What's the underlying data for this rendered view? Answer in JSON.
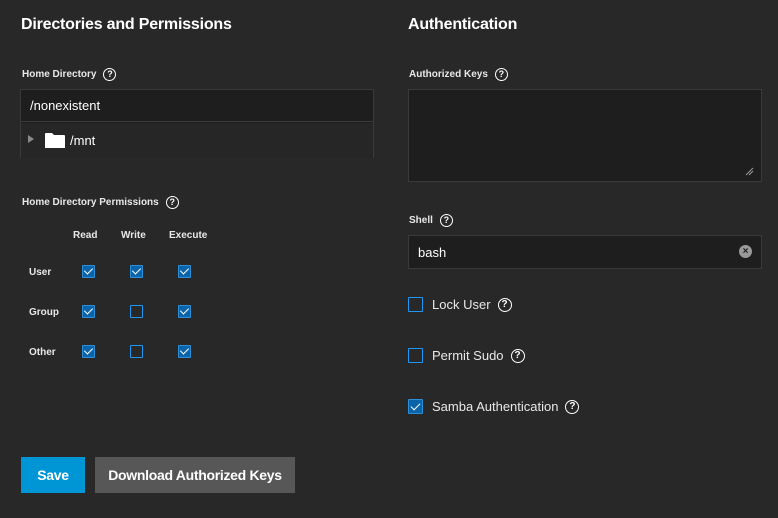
{
  "left": {
    "title": "Directories and Permissions",
    "home_directory": {
      "label": "Home Directory",
      "value": "/nonexistent",
      "tree_item": "/mnt"
    },
    "permissions": {
      "label": "Home Directory Permissions",
      "columns": [
        "Read",
        "Write",
        "Execute"
      ],
      "rows": [
        {
          "label": "User",
          "read": true,
          "write": true,
          "execute": true
        },
        {
          "label": "Group",
          "read": true,
          "write": false,
          "execute": true
        },
        {
          "label": "Other",
          "read": true,
          "write": false,
          "execute": true
        }
      ]
    }
  },
  "right": {
    "title": "Authentication",
    "authorized_keys": {
      "label": "Authorized Keys",
      "value": ""
    },
    "shell": {
      "label": "Shell",
      "value": "bash"
    },
    "checkboxes": [
      {
        "label": "Lock User",
        "checked": false
      },
      {
        "label": "Permit Sudo",
        "checked": false
      },
      {
        "label": "Samba Authentication",
        "checked": true
      }
    ]
  },
  "buttons": {
    "save": "Save",
    "download": "Download Authorized Keys"
  },
  "help_glyph": "?",
  "colors": {
    "background": "#282828",
    "accent": "#0095d5",
    "secondary_button": "#575757",
    "checkbox_checked": "#0b64a8"
  }
}
